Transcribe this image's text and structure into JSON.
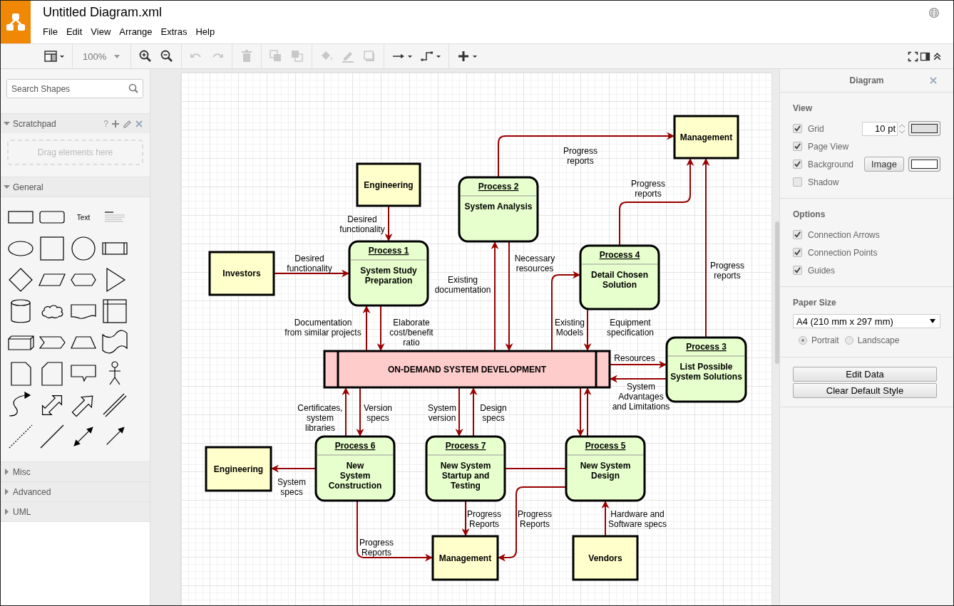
{
  "app": {
    "title": "Untitled Diagram.xml",
    "menu": [
      "File",
      "Edit",
      "View",
      "Arrange",
      "Extras",
      "Help"
    ]
  },
  "toolbar": {
    "zoom": "100%",
    "items": [
      {
        "disabled": false
      },
      {
        "disabled": false
      },
      {
        "disabled": false
      },
      {
        "disabled": true
      },
      {
        "disabled": true
      },
      {
        "disabled": true
      },
      {
        "disabled": true
      },
      {
        "disabled": true
      },
      {
        "disabled": true
      },
      {
        "disabled": true
      },
      {
        "disabled": true
      },
      {
        "disabled": false
      },
      {
        "disabled": false
      },
      {
        "disabled": false
      },
      {
        "disabled": false
      },
      {
        "disabled": false
      },
      {
        "disabled": false
      }
    ]
  },
  "sidebar": {
    "search": {
      "placeholder": "Search Shapes"
    },
    "scratchpad": {
      "title": "Scratchpad",
      "help": "?",
      "drop_hint": "Drag elements here",
      "expanded": true
    },
    "text_shape": "Text",
    "sections": [
      {
        "title": "General",
        "expanded": true
      },
      {
        "title": "Misc",
        "expanded": false
      },
      {
        "title": "Advanced",
        "expanded": false
      },
      {
        "title": "UML",
        "expanded": false
      }
    ]
  },
  "diagram": {
    "nodes": [
      {
        "kind": "entity",
        "label": "Management"
      },
      {
        "kind": "entity",
        "label": "Engineering"
      },
      {
        "kind": "process",
        "number": "Process 2",
        "title": "System Analysis"
      },
      {
        "kind": "entity",
        "label": "Investors"
      },
      {
        "kind": "process",
        "number": "Process 1",
        "title": "System Study\nPreparation"
      },
      {
        "kind": "process",
        "number": "Process 4",
        "title": "Detail Chosen\nSolution"
      },
      {
        "kind": "process",
        "number": "Process 3",
        "title": "List Possible\nSystem Solutions"
      },
      {
        "kind": "store",
        "label": "ON-DEMAND SYSTEM DEVELOPMENT"
      },
      {
        "kind": "entity",
        "label": "Engineering"
      },
      {
        "kind": "process",
        "number": "Process 6",
        "title": "New\nSystem\nConstruction"
      },
      {
        "kind": "process",
        "number": "Process 7",
        "title": "New System\nStartup and\nTesting"
      },
      {
        "kind": "process",
        "number": "Process 5",
        "title": "New System\nDesign"
      },
      {
        "kind": "entity",
        "label": "Management"
      },
      {
        "kind": "entity",
        "label": "Vendors"
      }
    ],
    "edges": [
      {
        "kind": "arrow",
        "label": "Progress\nreports"
      },
      {
        "kind": "arrow",
        "label": "Desired\nfunctionality"
      },
      {
        "kind": "arrow",
        "label": "Desired\nfunctionality"
      },
      {
        "kind": "arrow",
        "label": "Progress\nreports"
      },
      {
        "kind": "arrow",
        "label": "Progress\nreports"
      },
      {
        "kind": "arrow",
        "label": "Documentation\nfrom similar projects"
      },
      {
        "kind": "arrow",
        "label": "Elaborate\ncost/benefit\nratio"
      },
      {
        "kind": "arrow",
        "label": "Existing\ndocumentation"
      },
      {
        "kind": "arrow",
        "label": "Necessary\nresources"
      },
      {
        "kind": "arrow",
        "label": "Existing\nModels"
      },
      {
        "kind": "arrow",
        "label": "Equipment\nspecification"
      },
      {
        "kind": "arrow",
        "label": "Resources"
      },
      {
        "kind": "arrow",
        "label": "System\nAdvantages\nand Limitations"
      },
      {
        "kind": "arrow",
        "label": "Certificates,\nsystem\nlibraries"
      },
      {
        "kind": "arrow",
        "label": "Version\nspecs"
      },
      {
        "kind": "arrow",
        "label": "System\nversion"
      },
      {
        "kind": "arrow",
        "label": "Design\nspecs"
      },
      {
        "kind": "arrow"
      },
      {
        "kind": "arrow"
      },
      {
        "kind": "arrow",
        "label": "System\nspecs"
      },
      {
        "kind": "line"
      },
      {
        "kind": "arrow",
        "label": "Progress\nReports"
      },
      {
        "kind": "arrow",
        "label": "Progress\nReports"
      },
      {
        "kind": "arrow",
        "label": "Progress\nReports"
      },
      {
        "kind": "arrow",
        "label": "Hardware and\nSoftware specs"
      }
    ]
  },
  "format_panel": {
    "title": "Diagram",
    "view": {
      "title": "View",
      "items": [
        {
          "kind": "grid",
          "label": "Grid",
          "checked": true,
          "value": "10 pt"
        },
        {
          "kind": "plain",
          "label": "Page View",
          "checked": true
        },
        {
          "kind": "background",
          "label": "Background",
          "checked": true,
          "button": "Image"
        },
        {
          "kind": "plain",
          "label": "Shadow",
          "checked": false
        }
      ]
    },
    "options": {
      "title": "Options",
      "items": [
        {
          "label": "Connection Arrows",
          "checked": true
        },
        {
          "label": "Connection Points",
          "checked": true
        },
        {
          "label": "Guides",
          "checked": true
        }
      ]
    },
    "paper": {
      "title": "Paper Size",
      "value": "A4 (210 mm x 297 mm)",
      "orientations": [
        {
          "label": "Portrait",
          "selected": true
        },
        {
          "label": "Landscape",
          "selected": false
        }
      ]
    },
    "buttons": [
      "Edit Data",
      "Clear Default Style"
    ]
  }
}
